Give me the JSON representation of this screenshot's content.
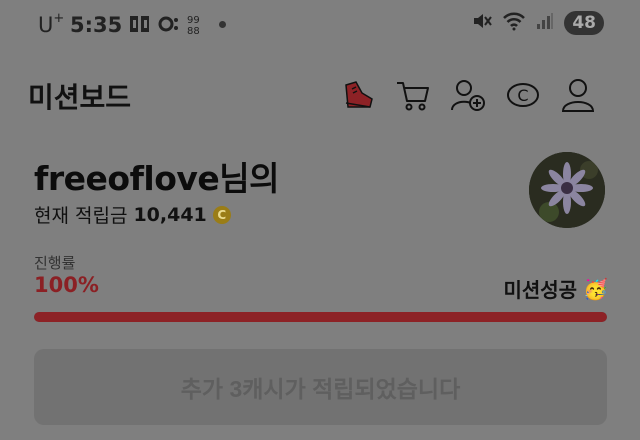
{
  "status_bar": {
    "carrier": "U",
    "carrier_sup": "+",
    "time": "5:35",
    "battery": "48",
    "icons": [
      "app-icon-1",
      "app-icon-2",
      "app-icon-3",
      "dot",
      "mute-icon",
      "wifi-icon",
      "signal-icon"
    ]
  },
  "header": {
    "title": "미션보드",
    "icons": [
      "shoe-icon",
      "cart-icon",
      "add-friend-icon",
      "coin-icon",
      "profile-icon"
    ]
  },
  "profile": {
    "greeting": "freeoflove님의",
    "points_label": "현재 적립금",
    "points_value": "10,441",
    "coin_symbol": "C"
  },
  "progress": {
    "label": "진행률",
    "value_text": "100%",
    "fraction": 1.0,
    "status": "미션성공",
    "status_emoji": "🥳"
  },
  "reward_button": {
    "label": "추가 3캐시가 적립되었습니다"
  },
  "colors": {
    "accent_red": "#8d2226",
    "overlay_gray": "#7f7f7f"
  }
}
